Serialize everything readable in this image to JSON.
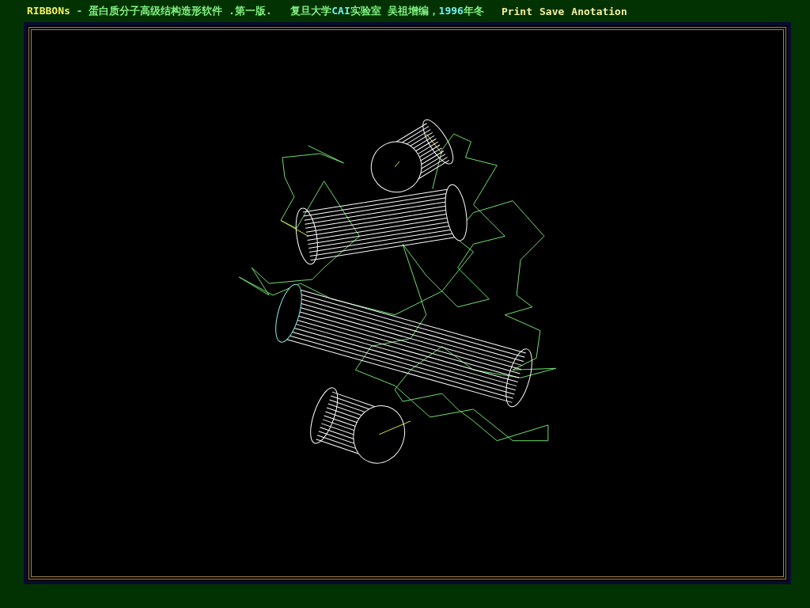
{
  "title_segments": [
    {
      "text": "RIBBONs",
      "color": "#f0f060"
    },
    {
      "text": " - 蛋白质分子高级结构造形软件 .第一版.   复旦大学",
      "color": "#80f080"
    },
    {
      "text": "CAI",
      "color": "#70f0f0"
    },
    {
      "text": "实验室 吴祖增编，",
      "color": "#80f080"
    },
    {
      "text": "1996",
      "color": "#70f0f0"
    },
    {
      "text": "年冬",
      "color": "#80f080"
    }
  ],
  "menu": [
    {
      "label": "Print"
    },
    {
      "label": "Save"
    },
    {
      "label": "Anotation"
    }
  ]
}
